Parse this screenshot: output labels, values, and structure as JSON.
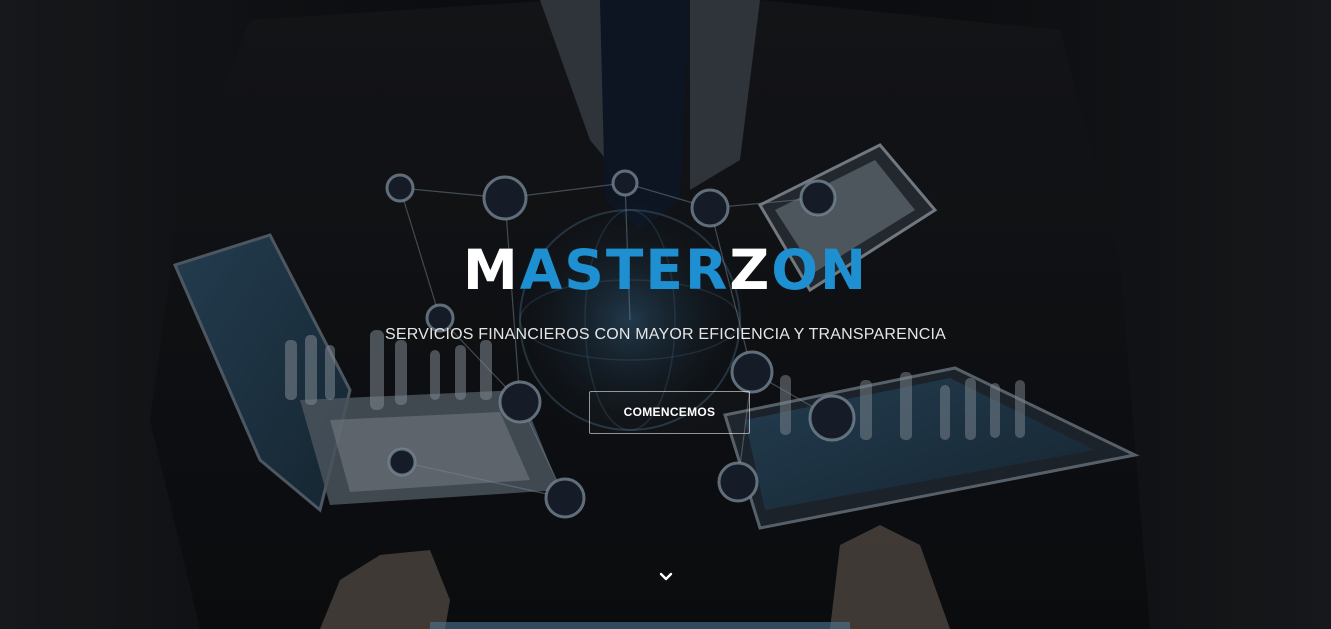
{
  "hero": {
    "brand_parts": [
      {
        "text": "M",
        "color": "#ffffff"
      },
      {
        "text": "ASTER",
        "color": "#1e8fd0"
      },
      {
        "text": "Z",
        "color": "#ffffff"
      },
      {
        "text": "ON",
        "color": "#1e8fd0"
      }
    ],
    "tagline": "SERVICIOS FINANCIEROS CON MAYOR EFICIENCIA Y TRANSPARENCIA",
    "cta_label": "COMENCEMOS",
    "scroll_icon": "chevron-down-icon"
  },
  "colors": {
    "accent": "#1e8fd0",
    "text": "#ffffff"
  }
}
